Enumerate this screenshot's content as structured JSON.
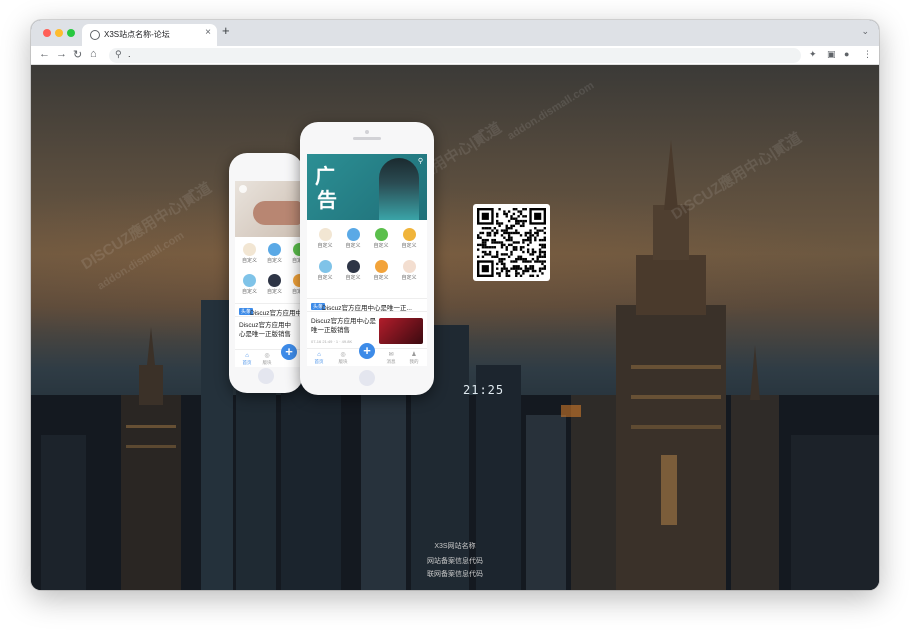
{
  "browser": {
    "tab_title": "X3S站点名称-论坛",
    "new_tab": "+",
    "tab_close": "×",
    "tab_menu": "⌄",
    "nav_back": "←",
    "nav_forward": "→",
    "nav_reload": "↻",
    "nav_home": "⌂",
    "search_glyph": "⚲",
    "url": ".",
    "ext_glyph": "✦",
    "panel_glyph": "▣",
    "profile_glyph": "●",
    "menu_glyph": "⋮"
  },
  "front_phone": {
    "banner_chars": [
      "广",
      "告"
    ],
    "search_glyph": "⚲",
    "grid": [
      {
        "label": "自定义",
        "color": "#f2e6d3"
      },
      {
        "label": "自定义",
        "color": "#5aa9e6"
      },
      {
        "label": "自定义",
        "color": "#5bbf4c"
      },
      {
        "label": "自定义",
        "color": "#f0b43a"
      },
      {
        "label": "自定义",
        "color": "#7fc3e8"
      },
      {
        "label": "自定义",
        "color": "#2e3546"
      },
      {
        "label": "自定义",
        "color": "#f2a33a"
      },
      {
        "label": "自定义",
        "color": "#f3ded0"
      }
    ],
    "news_tag": "头条",
    "news_text": "Discuz官方应用中心是唯一正...",
    "article_title": "Discuz官方应用中心是唯一正版销售",
    "article_meta": "07-16 21:49 · 1 · 49.8K",
    "nav": [
      {
        "icon": "⌂",
        "label": "首页"
      },
      {
        "icon": "◎",
        "label": "版块"
      },
      {
        "icon": "✉",
        "label": "消息"
      },
      {
        "icon": "♟",
        "label": "我的"
      }
    ],
    "plus": "+"
  },
  "back_phone": {
    "grid": [
      {
        "label": "自定义",
        "color": "#f2e6d3"
      },
      {
        "label": "自定义",
        "color": "#5aa9e6"
      },
      {
        "label": "自定义",
        "color": "#5bbf4c"
      },
      {
        "label": "自定义",
        "color": "#7fc3e8"
      },
      {
        "label": "自定义",
        "color": "#2e3546"
      },
      {
        "label": "自定义",
        "color": "#f2a33a"
      }
    ],
    "news_text": "Discuz官方应用中心",
    "article_title": "Discuz官方应用中心是唯一正版销售",
    "nav": [
      {
        "icon": "⌂",
        "label": "首页"
      },
      {
        "icon": "◎",
        "label": "版块"
      }
    ],
    "plus": "+"
  },
  "billboard": "21:25",
  "footer": {
    "site_name": "X3S网站名称",
    "icp": "网站备案信息代码",
    "police": "联网备案信息代码"
  },
  "watermark": [
    "DISCUZ應用中心|貳道",
    "addon.dismall.com"
  ]
}
